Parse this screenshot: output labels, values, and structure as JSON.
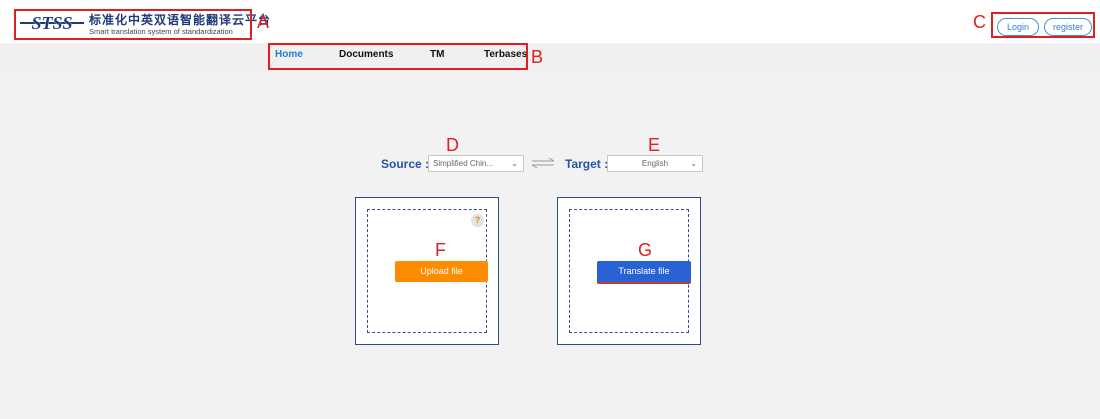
{
  "header": {
    "logo_mark": "STSS",
    "logo_title_cn": "标准化中英双语智能翻译云平台",
    "logo_subtitle_en": "Smart translation system of standardization",
    "login_label": "Login",
    "register_label": "register"
  },
  "nav": {
    "items": [
      {
        "label": "Home",
        "active": true
      },
      {
        "label": "Documents",
        "active": false
      },
      {
        "label": "TM",
        "active": false
      },
      {
        "label": "Terbases",
        "active": false
      }
    ]
  },
  "language": {
    "source_label": "Source :",
    "source_value": "Simplified Chin...",
    "target_label": "Target :",
    "target_value": "English",
    "swap_icon": "swap-arrows-icon"
  },
  "upload_panel": {
    "button_label": "Upload file",
    "help_icon": "?"
  },
  "translate_panel": {
    "button_label": "Translate file"
  },
  "annotations": {
    "a": "A",
    "b": "B",
    "c": "C",
    "d": "D",
    "e": "E",
    "f": "F",
    "g": "G"
  },
  "colors": {
    "annotation": "#e02020",
    "accent_blue": "#2a7ad5",
    "upload_orange": "#ff8c00",
    "translate_blue": "#2962d4",
    "label_blue": "#2852a8"
  }
}
